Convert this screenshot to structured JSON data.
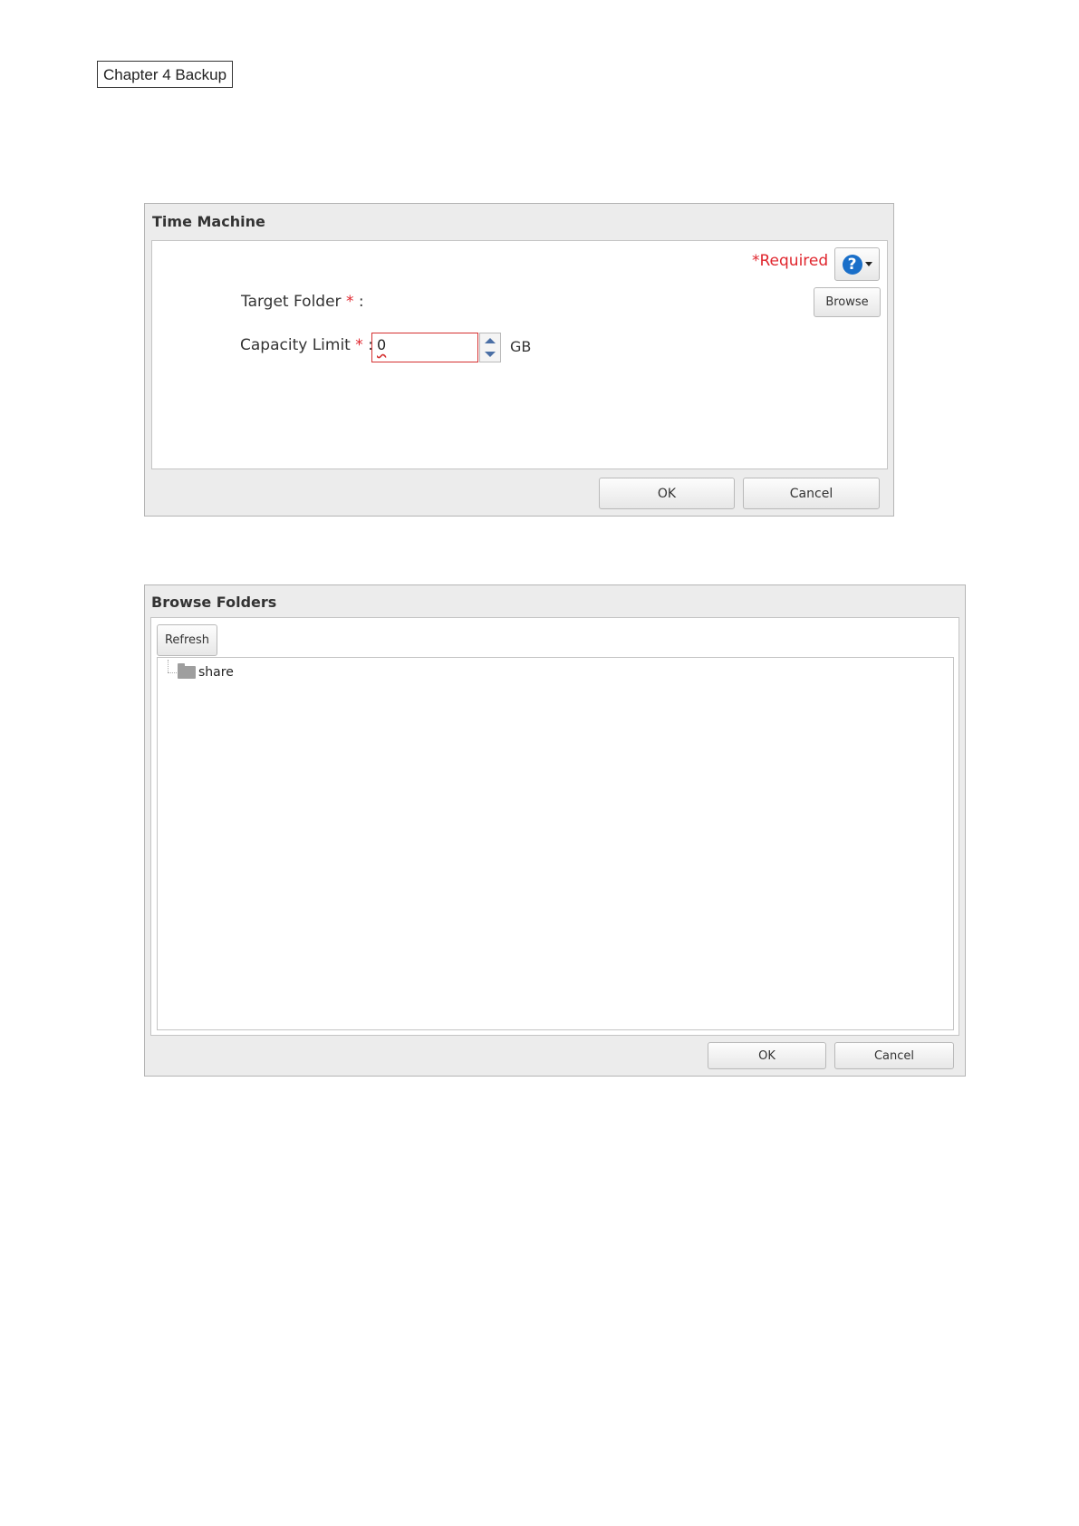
{
  "page": {
    "chapter_label": "Chapter 4 Backup"
  },
  "time_machine": {
    "title": "Time Machine",
    "required_note": "*Required",
    "help_icon": "question-icon",
    "target_folder_label": "Target Folder",
    "capacity_limit_label": "Capacity Limit",
    "required_star": "*",
    "colon": ":",
    "browse_label": "Browse",
    "capacity_value": "0",
    "capacity_unit": "GB",
    "ok_label": "OK",
    "cancel_label": "Cancel"
  },
  "browse_folders": {
    "title": "Browse Folders",
    "refresh_label": "Refresh",
    "tree": [
      {
        "label": "share",
        "icon": "folder-icon"
      }
    ],
    "ok_label": "OK",
    "cancel_label": "Cancel"
  },
  "colors": {
    "required": "#e0262e",
    "help_blue": "#1a6fc9",
    "dialog_bg": "#ececec"
  }
}
